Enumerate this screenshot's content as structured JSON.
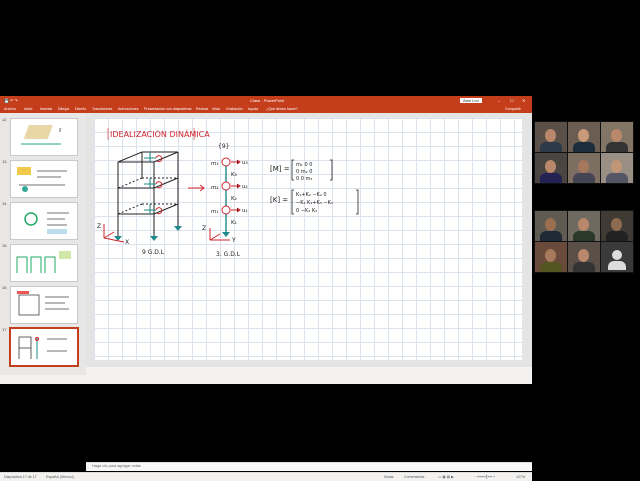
{
  "app": {
    "title": "Clase - PowerPoint",
    "user_badge": "Alan Lou",
    "window_controls": [
      "–",
      "☐",
      "✕"
    ]
  },
  "ribbon": {
    "tabs": [
      "Archivo",
      "Inicio",
      "Insertar",
      "Dibujar",
      "Diseño",
      "Transiciones",
      "Animaciones",
      "Presentación con diapositivas",
      "Revisar",
      "Vista",
      "Grabación",
      "Ayuda",
      "¿Qué desea hacer?"
    ],
    "share": "Compartir"
  },
  "thumbnails": [
    {
      "number": "12"
    },
    {
      "number": "13"
    },
    {
      "number": "14"
    },
    {
      "number": "15"
    },
    {
      "number": "16"
    },
    {
      "number": "17"
    }
  ],
  "slide": {
    "title_ink": "IDEALIZACIÓN DINÁMICA",
    "label_9gdl": "9 G.D.L",
    "label_3gdl": "3. G.D.L",
    "label_9": "{9}",
    "matrix_m_label": "[M] =",
    "matrix_m": [
      "m₁  0   0",
      "0  m₂  0",
      "0   0  m₃"
    ],
    "matrix_k_label": "[K] =",
    "matrix_k": [
      "K₁+K₂  −K₂   0",
      "−K₂  K₂+K₃  −K₃",
      "0   −K₃   K₃"
    ],
    "masses": [
      "m₃",
      "m₂",
      "m₁"
    ],
    "springs": [
      "K₃",
      "K₂",
      "K₁"
    ],
    "dofs": [
      "u₃",
      "u₂",
      "u₁"
    ],
    "axis_x": "X",
    "axis_y": "Y",
    "axis_z": "Z"
  },
  "notes_placeholder": "Haga clic para agregar notas",
  "status": {
    "slide_info": "Diapositiva 17 de 17",
    "language": "Español (México)",
    "notes": "Notas",
    "comments": "Comentarios",
    "zoom": "127%"
  },
  "colors": {
    "titlebar": "#c43e1c",
    "ink_red": "#d1262e",
    "ink_teal": "#1f8a8a",
    "ink_dark": "#222222"
  }
}
